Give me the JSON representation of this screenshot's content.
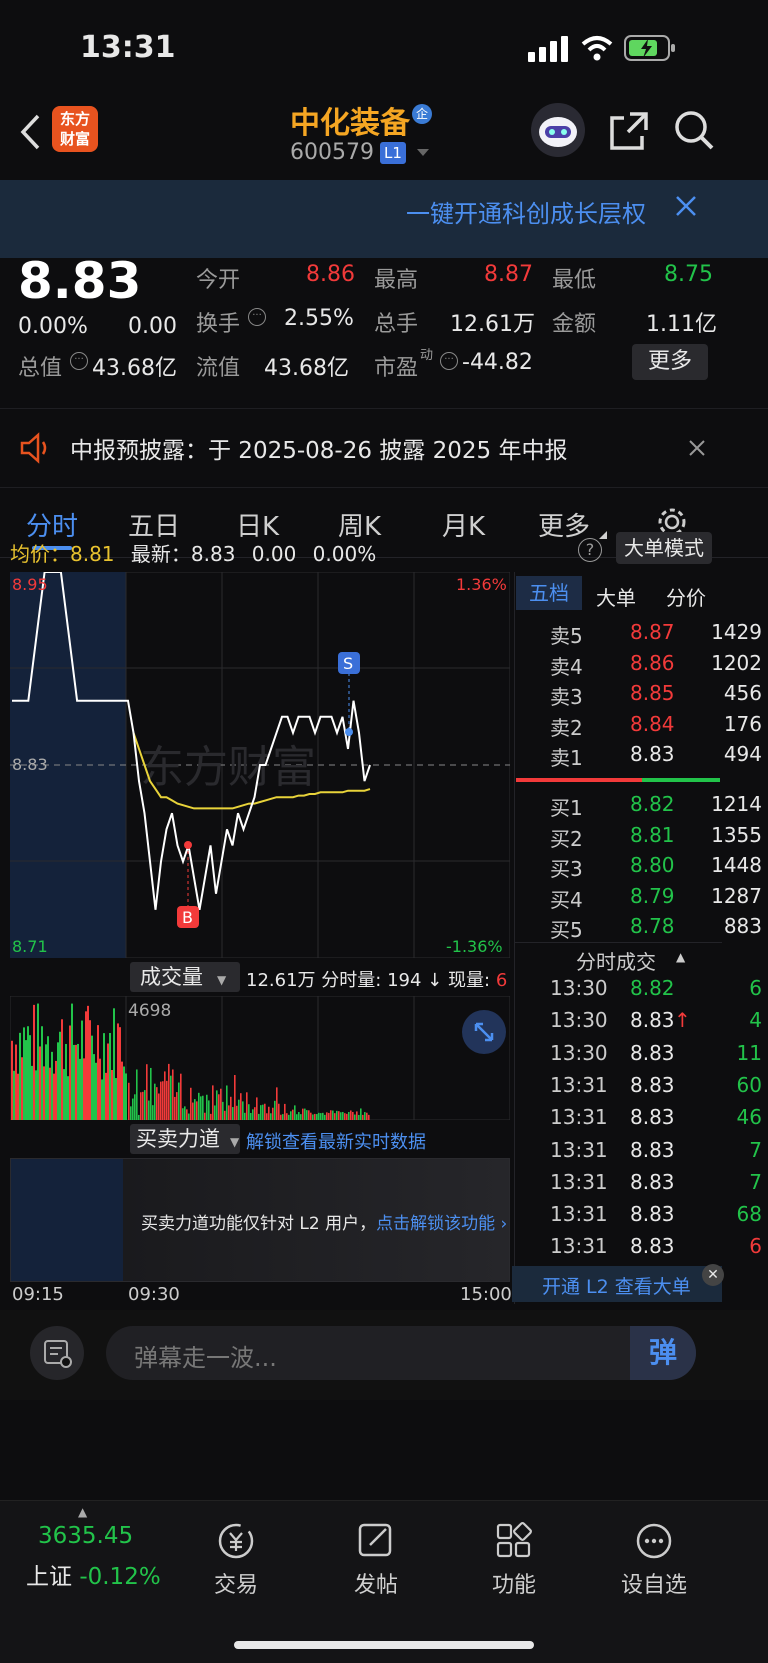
{
  "status": {
    "time": "13:31"
  },
  "header": {
    "logo_line1": "东方",
    "logo_line2": "财富",
    "stock_name": "中化装备",
    "badge": "企",
    "code": "600579",
    "level": "L1"
  },
  "banner": {
    "text": "一键开通科创成长层权"
  },
  "quote": {
    "price": "8.83",
    "change_pct": "0.00%",
    "change": "0.00",
    "open_label": "今开",
    "open": "8.86",
    "high_label": "最高",
    "high": "8.87",
    "low_label": "最低",
    "low": "8.75",
    "turnover_label": "换手",
    "turnover": "2.55%",
    "vol_label": "总手",
    "vol": "12.61万",
    "amount_label": "金额",
    "amount": "1.11亿",
    "mcap_label": "总值",
    "mcap": "43.68亿",
    "float_label": "流值",
    "float": "43.68亿",
    "pe_label": "市盈",
    "pe_sup": "动",
    "pe": "-44.82",
    "more": "更多"
  },
  "notice": {
    "text": "中报预披露：于 2025-08-26 披露 2025 年中报"
  },
  "tabs": [
    "分时",
    "五日",
    "日K",
    "周K",
    "月K",
    "更多"
  ],
  "chart_info": {
    "avg_label": "均价：",
    "avg": "8.81",
    "last_label": "最新：",
    "last": "8.83",
    "chg": "0.00",
    "pct": "0.00%",
    "mode": "大单模式"
  },
  "chart_data": {
    "type": "line",
    "ylim": [
      8.71,
      8.95
    ],
    "prev_close": 8.83,
    "y_labels": {
      "top": "8.95",
      "mid": "8.83",
      "bottom": "8.71",
      "top_pct": "1.36%",
      "bottom_pct": "-1.36%"
    },
    "price": [
      8.87,
      8.87,
      8.95,
      8.95,
      8.87,
      8.87,
      8.87,
      8.87,
      8.87,
      8.85,
      8.82,
      8.8,
      8.77,
      8.74,
      8.77,
      8.79,
      8.8,
      8.78,
      8.77,
      8.78,
      8.76,
      8.74,
      8.76,
      8.78,
      8.75,
      8.77,
      8.79,
      8.78,
      8.8,
      8.79,
      8.8,
      8.81,
      8.83,
      8.83,
      8.84,
      8.85,
      8.86,
      8.86,
      8.85,
      8.86,
      8.86,
      8.86,
      8.85,
      8.86,
      8.86,
      8.86,
      8.85,
      8.86,
      8.84,
      8.87,
      8.85,
      8.82,
      8.83
    ],
    "avg": [
      null,
      null,
      null,
      null,
      null,
      null,
      null,
      null,
      null,
      8.85,
      8.84,
      8.83,
      8.82,
      8.815,
      8.81,
      8.81,
      8.808,
      8.806,
      8.805,
      8.804,
      8.803,
      8.803,
      8.803,
      8.803,
      8.803,
      8.803,
      8.803,
      8.803,
      8.804,
      8.805,
      8.806,
      8.806,
      8.807,
      8.808,
      8.809,
      8.81,
      8.81,
      8.81,
      8.81,
      8.811,
      8.811,
      8.812,
      8.812,
      8.813,
      8.813,
      8.813,
      8.813,
      8.813,
      8.814,
      8.814,
      8.814,
      8.814,
      8.815
    ],
    "buy_marker": "B",
    "sell_marker": "S",
    "watermark": "东方财富",
    "x_labels": [
      "09:15",
      "09:30",
      "15:00"
    ]
  },
  "volume": {
    "label": "成交量",
    "total": "12.61万",
    "min_label": "分时量:",
    "min_val": "194",
    "arrow": "↓",
    "now_label": "现量:",
    "now_val": "6",
    "peak": "4698"
  },
  "force": {
    "label": "买卖力道",
    "unlock": "解锁查看最新实时数据",
    "msg": "买卖力道功能仅针对 L2 用户，",
    "msg_link": "点击解锁该功能"
  },
  "orderbook": {
    "tabs": [
      "五档",
      "大单",
      "分价"
    ],
    "asks": [
      {
        "l": "卖5",
        "p": "8.87",
        "v": "1429"
      },
      {
        "l": "卖4",
        "p": "8.86",
        "v": "1202"
      },
      {
        "l": "卖3",
        "p": "8.85",
        "v": "456"
      },
      {
        "l": "卖2",
        "p": "8.84",
        "v": "176"
      },
      {
        "l": "卖1",
        "p": "8.83",
        "v": "494"
      }
    ],
    "bids": [
      {
        "l": "买1",
        "p": "8.82",
        "v": "1214"
      },
      {
        "l": "买2",
        "p": "8.81",
        "v": "1355"
      },
      {
        "l": "买3",
        "p": "8.80",
        "v": "1448"
      },
      {
        "l": "买4",
        "p": "8.79",
        "v": "1287"
      },
      {
        "l": "买5",
        "p": "8.78",
        "v": "883"
      }
    ]
  },
  "trades": {
    "title": "分时成交",
    "rows": [
      {
        "t": "13:30",
        "p": "8.82",
        "v": "6",
        "pc": "green",
        "vc": "green"
      },
      {
        "t": "13:30",
        "p": "8.83",
        "a": "↑",
        "v": "4",
        "pc": "white",
        "vc": "green"
      },
      {
        "t": "13:30",
        "p": "8.83",
        "v": "11",
        "pc": "white",
        "vc": "green"
      },
      {
        "t": "13:31",
        "p": "8.83",
        "v": "60",
        "pc": "white",
        "vc": "green"
      },
      {
        "t": "13:31",
        "p": "8.83",
        "v": "46",
        "pc": "white",
        "vc": "green"
      },
      {
        "t": "13:31",
        "p": "8.83",
        "v": "7",
        "pc": "white",
        "vc": "green"
      },
      {
        "t": "13:31",
        "p": "8.83",
        "v": "7",
        "pc": "white",
        "vc": "green"
      },
      {
        "t": "13:31",
        "p": "8.83",
        "v": "68",
        "pc": "white",
        "vc": "green"
      },
      {
        "t": "13:31",
        "p": "8.83",
        "v": "6",
        "pc": "white",
        "vc": "red"
      }
    ],
    "l2": "开通 L2 查看大单"
  },
  "danmu": {
    "placeholder": "弹幕走一波...",
    "btn": "弹"
  },
  "nav": {
    "index_val": "3635.45",
    "index_name": "上证",
    "index_pct": "-0.12%",
    "items": [
      "交易",
      "发帖",
      "功能",
      "设自选"
    ]
  }
}
